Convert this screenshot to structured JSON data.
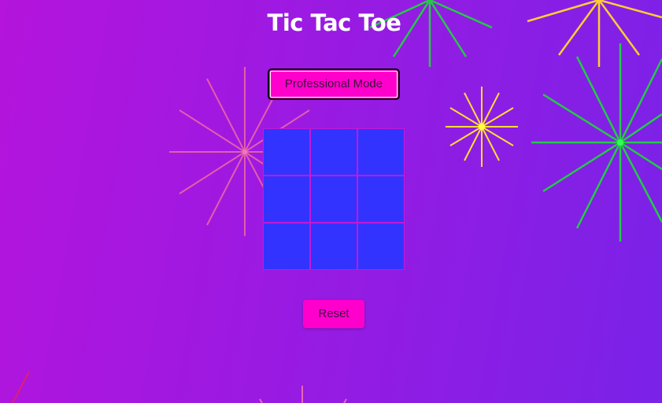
{
  "game": {
    "title": "Tic Tac Toe",
    "mode_button_label": "Professional Mode",
    "reset_button_label": "Reset",
    "board": {
      "rows": 3,
      "cols": 3,
      "cells": [
        "",
        "",
        "",
        "",
        "",
        "",
        "",
        "",
        ""
      ]
    }
  },
  "colors": {
    "background_start": "#b414dc",
    "background_end": "#7a22e8",
    "button": "#ff00cc",
    "cell": "#3333ff",
    "cell_border": "#c418d8",
    "firework_green": "#22cc44",
    "firework_yellow": "#ffdd33",
    "firework_pink": "#ff6699"
  }
}
